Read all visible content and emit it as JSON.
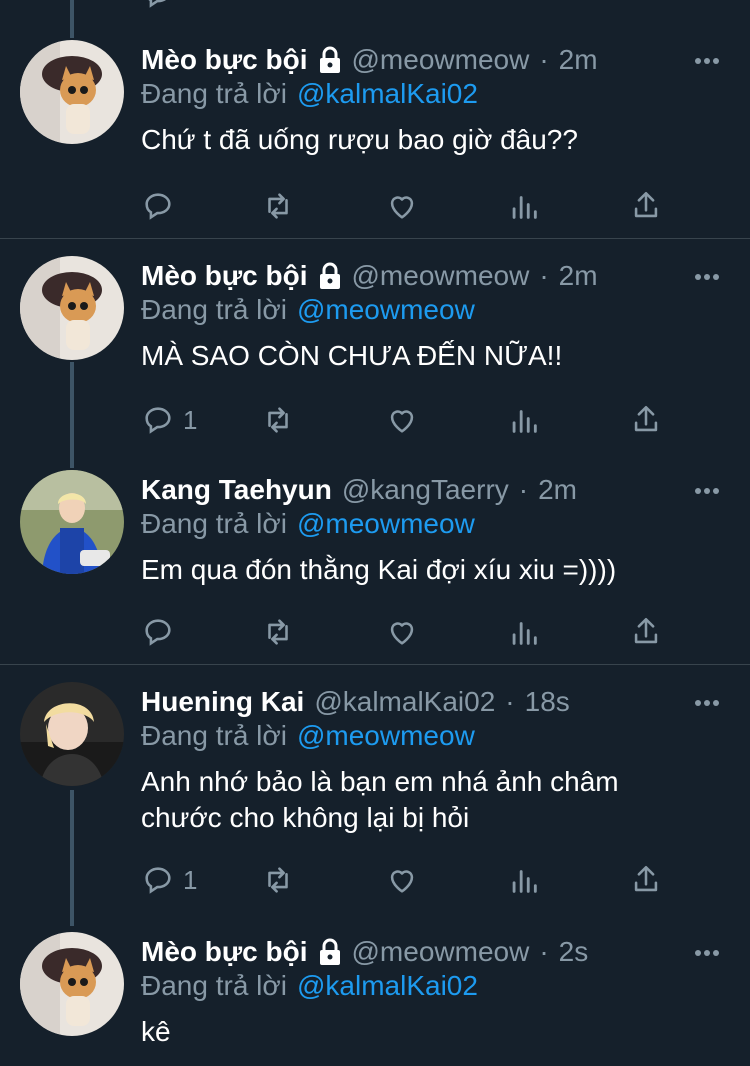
{
  "tweets": [
    {
      "name": "Mèo bực bội",
      "locked": true,
      "handle": "@meowmeow",
      "time": "2m",
      "replying_label": "Đang trả lời",
      "replying_to": "@kalmalKai02",
      "text": "Chứ t đã uống rượu bao giờ đâu??",
      "reply_count": "",
      "avatar": "cat-avatar"
    },
    {
      "name": "Mèo bực bội",
      "locked": true,
      "handle": "@meowmeow",
      "time": "2m",
      "replying_label": "Đang trả lời",
      "replying_to": "@meowmeow",
      "text": "MÀ SAO CÒN CHƯA ĐẾN NỮA!!",
      "reply_count": "1",
      "avatar": "cat-avatar"
    },
    {
      "name": "Kang Taehyun",
      "locked": false,
      "handle": "@kangTaerry",
      "time": "2m",
      "replying_label": "Đang trả lời",
      "replying_to": "@meowmeow",
      "text": "Em qua đón thằng Kai đợi xíu xiu =))))",
      "reply_count": "",
      "avatar": "person-blue-jacket-avatar"
    },
    {
      "name": "Huening Kai",
      "locked": false,
      "handle": "@kalmalKai02",
      "time": "18s",
      "replying_label": "Đang trả lời",
      "replying_to": "@meowmeow",
      "text": "Anh nhớ bảo là bạn em nhá ảnh châm chước cho không lại bị hỏi",
      "reply_count": "1",
      "avatar": "person-blonde-avatar"
    },
    {
      "name": "Mèo bực bội",
      "locked": true,
      "handle": "@meowmeow",
      "time": "2s",
      "replying_label": "Đang trả lời",
      "replying_to": "@kalmalKai02",
      "text": "kê",
      "reply_count": "",
      "avatar": "cat-avatar"
    }
  ],
  "colors": {
    "background": "#15202b",
    "secondary_text": "#8899a6",
    "mention": "#1d9bf0",
    "divider": "#38444d",
    "thread_line": "#3d5466"
  }
}
